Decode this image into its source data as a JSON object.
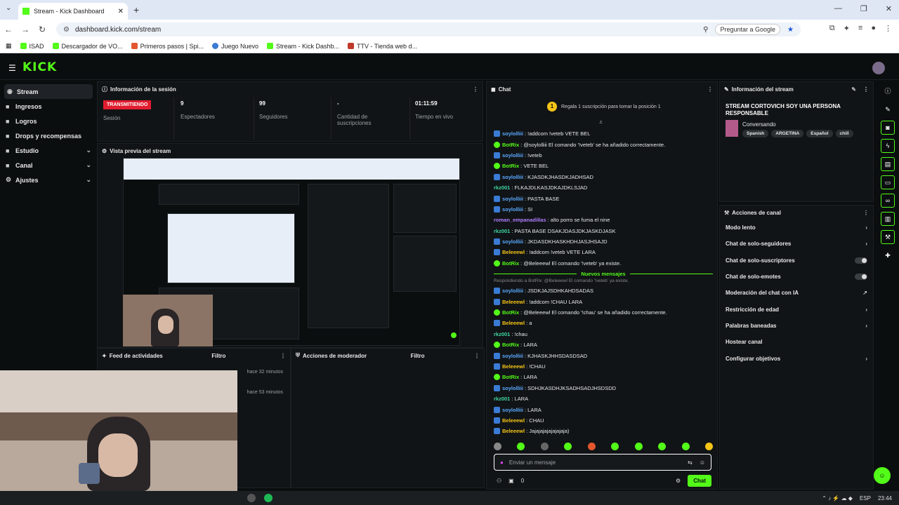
{
  "browser": {
    "tab_title": "Stream - Kick Dashboard",
    "url": "dashboard.kick.com/stream",
    "ask_google": "Preguntar a Google",
    "bookmarks": [
      "ISAD",
      "Descargador de VO...",
      "Primeros pasos | Spi...",
      "Juego Nuevo",
      "Stream - Kick Dashb...",
      "TTV - Tienda web d..."
    ]
  },
  "app": {
    "logo": "KICK"
  },
  "sidebar": {
    "items": [
      {
        "label": "Stream",
        "active": true,
        "chevron": false
      },
      {
        "label": "Ingresos",
        "chevron": false
      },
      {
        "label": "Logros",
        "chevron": false
      },
      {
        "label": "Drops y recompensas",
        "chevron": false
      },
      {
        "label": "Estudio",
        "chevron": true
      },
      {
        "label": "Canal",
        "chevron": true
      },
      {
        "label": "Ajustes",
        "chevron": true
      }
    ]
  },
  "session": {
    "title": "Información de la sesión",
    "status_badge": "TRANSMITIENDO",
    "status_label": "Sesión",
    "viewers_value": "9",
    "viewers_label": "Espectadores",
    "followers_value": "99",
    "followers_label": "Seguidores",
    "subs_value": "-",
    "subs_label": "Cantidad de suscripciones",
    "uptime_value": "01:11:59",
    "uptime_label": "Tiempo en vivo"
  },
  "preview": {
    "title": "Vista previa del stream"
  },
  "feed": {
    "title": "Feed de actividades",
    "filter": "Filtro",
    "times": [
      "hace 32 minutos",
      "hace 53 minutos"
    ]
  },
  "mod": {
    "title": "Acciones de moderador",
    "filter": "Filtro"
  },
  "chat": {
    "title": "Chat",
    "gift_badge": "1",
    "gift_text": "Regala 1 suscripción para tomar la posición 1",
    "new_messages": "Nuevos mensajes",
    "replying": "Respondiendo a BotRix: @Beleeewl El comando '!veteb' ya existe.",
    "messages_before": [
      {
        "user": "soylolliii",
        "text": ": !addcom !veteb VETE BEL",
        "color": "#5aa9ff",
        "badge": "b"
      },
      {
        "user": "BotRix",
        "text": ": @soylolliii El comando '!veteb' se ha añadido correctamente.",
        "color": "#53fc18",
        "badge": "g"
      },
      {
        "user": "soylolliii",
        "text": ": !veteb",
        "color": "#5aa9ff",
        "badge": "b"
      },
      {
        "user": "BotRix",
        "text": ": VETE BEL",
        "color": "#53fc18",
        "badge": "g"
      },
      {
        "user": "soylolliii",
        "text": ": KJASDKJHASDKJADHSAD",
        "color": "#5aa9ff",
        "badge": "b"
      },
      {
        "user": "rkz001",
        "text": ": FLKAJDLKASJDKAJDKLSJAD",
        "color": "#3ed6a0",
        "badge": ""
      },
      {
        "user": "soylolliii",
        "text": ": PASTA BASE",
        "color": "#5aa9ff",
        "badge": "b"
      },
      {
        "user": "soylolliii",
        "text": ": SI",
        "color": "#5aa9ff",
        "badge": "b"
      },
      {
        "user": "roman_empanadillas",
        "text": ": alto porro se fuma el nine",
        "color": "#b07cff",
        "badge": ""
      },
      {
        "user": "rkz001",
        "text": ": PASTA BASE DSAKJDASJDKJASKDJASK",
        "color": "#3ed6a0",
        "badge": ""
      },
      {
        "user": "soylolliii",
        "text": ": JKDASDKHASKHDHJASJHSAJD",
        "color": "#5aa9ff",
        "badge": "b"
      },
      {
        "user": "Beleeewl",
        "text": ": !addcom !veteb VETE LARA",
        "color": "#f5c518",
        "badge": "b"
      },
      {
        "user": "BotRix",
        "text": ": @Beleeewl El comando '!veteb' ya existe.",
        "color": "#53fc18",
        "badge": "g"
      }
    ],
    "messages_after": [
      {
        "user": "soylolliii",
        "text": ": JSDKJAJSDHKAHDSADAS",
        "color": "#5aa9ff",
        "badge": "b"
      },
      {
        "user": "Beleeewl",
        "text": ": !addcom !CHAU LARA",
        "color": "#f5c518",
        "badge": "b"
      },
      {
        "user": "BotRix",
        "text": ": @Beleeewl El comando '!chau' se ha añadido correctamente.",
        "color": "#53fc18",
        "badge": "g"
      },
      {
        "user": "Beleeewl",
        "text": ": a",
        "color": "#f5c518",
        "badge": "b"
      },
      {
        "user": "rkz001",
        "text": ": !chau",
        "color": "#3ed6a0",
        "badge": ""
      },
      {
        "user": "BotRix",
        "text": ": LARA",
        "color": "#53fc18",
        "badge": "g"
      },
      {
        "user": "soylolliii",
        "text": ": KJHASKJHHSDASDSAD",
        "color": "#5aa9ff",
        "badge": "b"
      },
      {
        "user": "Beleeewl",
        "text": ": !CHAU",
        "color": "#f5c518",
        "badge": "b"
      },
      {
        "user": "BotRix",
        "text": ": LARA",
        "color": "#53fc18",
        "badge": "g"
      },
      {
        "user": "soylolliii",
        "text": ": SDHJKASDHJKSADHSADJHSDSDD",
        "color": "#5aa9ff",
        "badge": "b"
      },
      {
        "user": "rkz001",
        "text": ": LARA",
        "color": "#3ed6a0",
        "badge": ""
      },
      {
        "user": "soylolliii",
        "text": ": LARA",
        "color": "#5aa9ff",
        "badge": "b"
      },
      {
        "user": "Beleeewl",
        "text": ": CHAU",
        "color": "#f5c518",
        "badge": "b"
      },
      {
        "user": "Beleeewl",
        "text": ": Jajajajajajajajaja)",
        "color": "#f5c518",
        "badge": "b"
      }
    ],
    "input_placeholder": "Enviar un mensaje",
    "footer_count": "0",
    "send_label": "Chat"
  },
  "stream_info": {
    "title": "Información del stream",
    "stream_title": "STREAM CORTOVICH SOY UNA PERSONA RESPONSABLE",
    "category": "Conversando",
    "tags": [
      "Spanish",
      "ARGETINA",
      "Español",
      "chill"
    ]
  },
  "channel_actions": {
    "title": "Acciones de canal",
    "items": [
      {
        "label": "Modo lento",
        "control": "chevron"
      },
      {
        "label": "Chat de solo-seguidores",
        "control": "chevron"
      },
      {
        "label": "Chat de solo-suscriptores",
        "control": "toggle"
      },
      {
        "label": "Chat de solo-emotes",
        "control": "toggle"
      },
      {
        "label": "Moderación del chat con IA",
        "control": "external"
      },
      {
        "label": "Restricción de edad",
        "control": "chevron"
      },
      {
        "label": "Palabras baneadas",
        "control": "chevron"
      },
      {
        "label": "Hostear canal",
        "control": "none"
      },
      {
        "label": "Configurar objetivos",
        "control": "chevron"
      }
    ]
  },
  "taskbar": {
    "lang": "ESP",
    "time": "23:44"
  },
  "colors": {
    "accent": "#53fc18",
    "live": "#e11d2f",
    "bg": "#0b0e0f"
  }
}
